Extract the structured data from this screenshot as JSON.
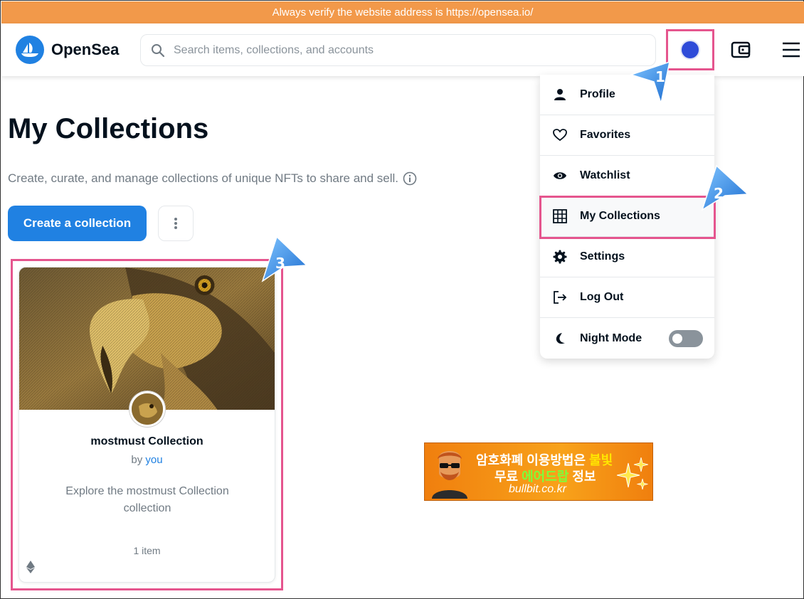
{
  "banner": {
    "text": "Always verify the website address is https://opensea.io/"
  },
  "header": {
    "logo_text": "OpenSea",
    "search_placeholder": "Search items, collections, and accounts"
  },
  "page": {
    "title": "My Collections",
    "subtitle": "Create, curate, and manage collections of unique NFTs to share and sell.",
    "create_button": "Create a collection"
  },
  "collection_card": {
    "name": "mostmust Collection",
    "by_prefix": "by",
    "by_user": "you",
    "description": "Explore the mostmust Collection collection",
    "item_count": "1 item"
  },
  "dropdown": {
    "items": [
      {
        "label": "Profile",
        "icon": "person-icon"
      },
      {
        "label": "Favorites",
        "icon": "heart-icon"
      },
      {
        "label": "Watchlist",
        "icon": "eye-icon"
      },
      {
        "label": "My Collections",
        "icon": "grid-icon"
      },
      {
        "label": "Settings",
        "icon": "gear-icon"
      },
      {
        "label": "Log Out",
        "icon": "logout-icon"
      },
      {
        "label": "Night Mode",
        "icon": "moon-icon"
      }
    ],
    "night_mode_on": false
  },
  "annotations": {
    "step1": "1",
    "step2": "2",
    "step3": "3"
  },
  "ad": {
    "line1_a": "암호화폐 이용방법은 ",
    "line1_b": "불빛",
    "line2_a": "무료 ",
    "line2_b": "에어드랍",
    "line2_c": " 정보",
    "line3": "bullbit.co.kr"
  },
  "colors": {
    "brand": "#2081e2",
    "banner": "#f2994a",
    "highlight": "#e5558e"
  }
}
